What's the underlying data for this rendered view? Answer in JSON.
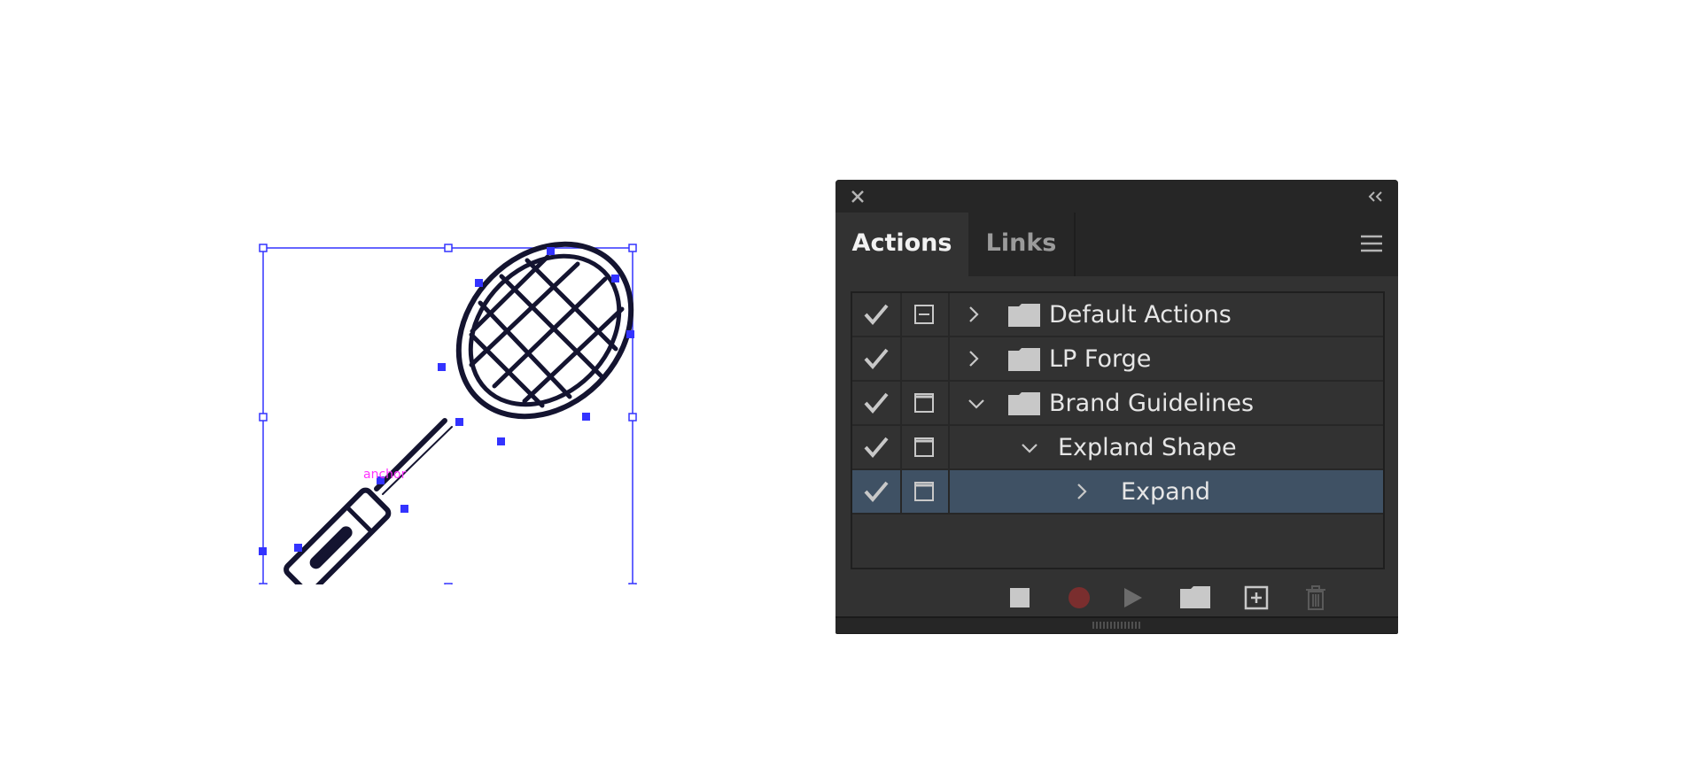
{
  "canvas": {
    "anchor_label": "anchor",
    "colors": {
      "selection": "#3333ff",
      "stroke": "#141430",
      "anchor_text": "#ff33ff"
    }
  },
  "panel": {
    "tabs": [
      {
        "label": "Actions",
        "active": true
      },
      {
        "label": "Links",
        "active": false
      }
    ],
    "icons": {
      "close": "close-icon",
      "collapse": "double-chevron-left-icon",
      "menu": "hamburger-menu-icon"
    },
    "rows": [
      {
        "label": "Default Actions",
        "checked": true,
        "dialog": "partial",
        "expanded": false,
        "type": "set",
        "level": 0,
        "selected": false
      },
      {
        "label": "LP Forge",
        "checked": true,
        "dialog": "none",
        "expanded": false,
        "type": "set",
        "level": 0,
        "selected": false
      },
      {
        "label": "Brand Guidelines",
        "checked": true,
        "dialog": "on",
        "expanded": true,
        "type": "set",
        "level": 0,
        "selected": false
      },
      {
        "label": "Expland Shape",
        "checked": true,
        "dialog": "on",
        "expanded": true,
        "type": "action",
        "level": 1,
        "selected": false
      },
      {
        "label": "Expand",
        "checked": true,
        "dialog": "on",
        "expanded": false,
        "type": "command",
        "level": 2,
        "selected": true
      }
    ],
    "toolbar": [
      {
        "name": "stop-icon",
        "enabled": true
      },
      {
        "name": "record-icon",
        "enabled": false
      },
      {
        "name": "play-icon",
        "enabled": false
      },
      {
        "name": "new-set-folder-icon",
        "enabled": true
      },
      {
        "name": "new-action-icon",
        "enabled": true
      },
      {
        "name": "delete-trash-icon",
        "enabled": false
      }
    ],
    "colors": {
      "panel_bg": "#323232",
      "tab_bar": "#262626",
      "selected_row": "#3f5164",
      "text": "#e6e6e6",
      "record_red": "#7a2e2e"
    }
  }
}
